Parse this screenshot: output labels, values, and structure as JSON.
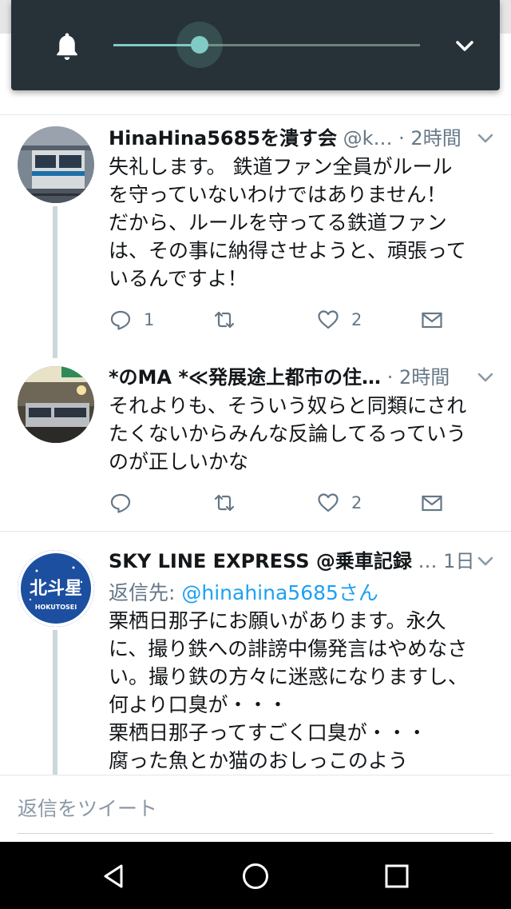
{
  "volume_panel": {
    "icon": "bell-icon",
    "level": 0.28,
    "accent_color": "#80cbc4",
    "expand_icon": "chevron-down-icon"
  },
  "tweets": [
    {
      "name": "HinaHina5685を潰す会",
      "handle": "@k…",
      "time": "· 2時間",
      "avatar": "train-photo",
      "text_lines": [
        "失礼します。 鉄道ファン全員がルール",
        "を守っていないわけではありません！",
        "だから、ルールを守ってる鉄道ファン",
        "は、その事に納得させようと、頑張って",
        "いるんですよ！"
      ],
      "reply_count": "1",
      "retweet_count": "",
      "like_count": "2"
    },
    {
      "name": "*のMA *≪発展途上都市の住…",
      "handle": "",
      "time": "· 2時間",
      "avatar": "station-photo",
      "text_lines": [
        "それよりも、そういう奴らと同類にされ",
        "たくないからみんな反論してるっていう",
        "のが正しいかな"
      ],
      "reply_count": "",
      "retweet_count": "",
      "like_count": "2"
    },
    {
      "name": "SKY LINE EXPRESS @乗車記録",
      "handle": "…",
      "time": "1日",
      "avatar": "hokutosei-logo",
      "avatar_text": "北斗星",
      "avatar_subtext": "HOKUTOSEI",
      "reply_prefix": "返信先: ",
      "reply_mention": "@hinahina5685さん",
      "text_lines": [
        "栗栖日那子にお願いがあります。永久",
        "に、撮り鉄への誹謗中傷発言はやめなさ",
        "い。撮り鉄の方々に迷惑になりますし、",
        "何より口臭が・・・",
        "栗栖日那子ってすごく口臭が・・・",
        "腐った魚とか猫のおしっこのよう"
      ]
    }
  ],
  "compose": {
    "placeholder": "返信をツイート"
  },
  "colors": {
    "link": "#1da1f2",
    "muted": "#657786",
    "divider": "#e1e8ed"
  },
  "navbar": {
    "icons": [
      "back-icon",
      "home-icon",
      "recents-icon"
    ]
  }
}
